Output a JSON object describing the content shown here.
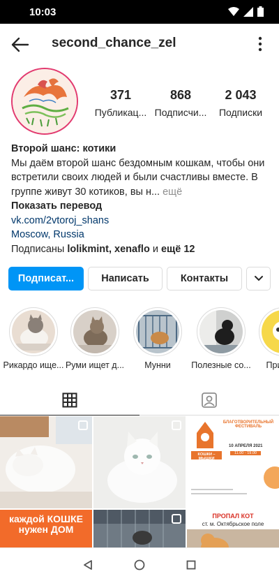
{
  "status_bar": {
    "time": "10:03"
  },
  "header": {
    "username": "second_chance_zel"
  },
  "profile": {
    "stats": [
      {
        "value": "371",
        "label": "Публикац..."
      },
      {
        "value": "868",
        "label": "Подписчи..."
      },
      {
        "value": "2 043",
        "label": "Подписки"
      }
    ],
    "name": "Второй шанс: котики",
    "bio": "Мы даём второй шанс бездомным кошкам, чтобы они встретили своих людей и были счастливы вместе. В группе живут 30 котиков, вы н...",
    "more_label": "ещё",
    "translate_label": "Показать перевод",
    "link": "vk.com/2vtoroj_shans",
    "location": "Moscow, Russia",
    "followed_by_prefix": "Подписаны ",
    "followed_by_users": "lolikmint, xenaflo",
    "followed_by_and": " и ",
    "followed_by_more": "ещё 12"
  },
  "actions": {
    "follow_label": "Подписат...",
    "message_label": "Написать",
    "contacts_label": "Контакты"
  },
  "highlights": [
    {
      "label": "Рикардо ище..."
    },
    {
      "label": "Руми ищет д..."
    },
    {
      "label": "Мунни"
    },
    {
      "label": "Полезные со..."
    },
    {
      "label": "Приме..."
    }
  ],
  "posts": [
    {
      "text": ""
    },
    {
      "text": ""
    },
    {
      "title": "БЛАГОТВОРИТЕЛЬНЫЙ ФЕСТИВАЛЬ",
      "brand": "КОШКИ – МЫШКИ",
      "date": "10 АПРЕЛЯ 2021",
      "time": "11.00 - 19.00"
    },
    {
      "title": "каждой КОШКЕ нужен ДОМ"
    },
    {
      "text": ""
    },
    {
      "title": "ПРОПАЛ КОТ",
      "subtitle": "ст. м. Октябрьское поле"
    }
  ],
  "colors": {
    "accent": "#0095f6",
    "ring": "#e23a6f",
    "link": "#00376b"
  }
}
